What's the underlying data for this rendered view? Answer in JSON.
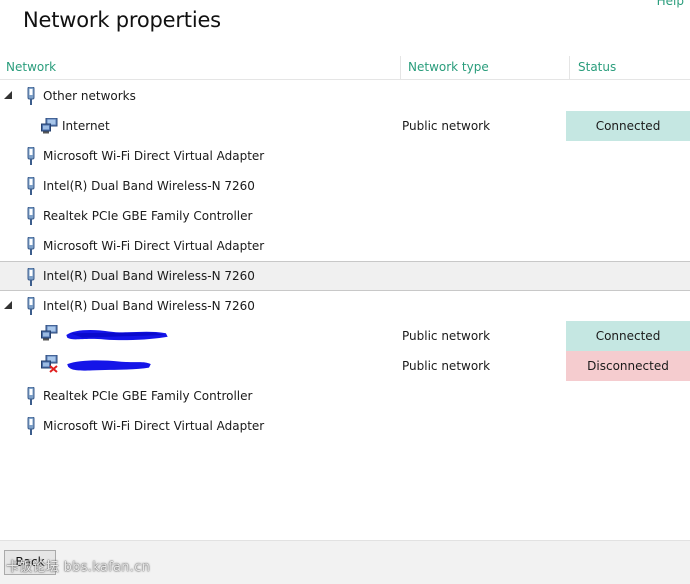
{
  "header": {
    "title": "Network properties",
    "help_label": "Help"
  },
  "columns": {
    "network": "Network",
    "network_type": "Network type",
    "status": "Status"
  },
  "colors": {
    "accent": "#2a9d7c",
    "connected": "#c5e7e2",
    "disconnected": "#f5cccf"
  },
  "rows": [
    {
      "kind": "group",
      "label": "Other networks",
      "expanded": true,
      "icon": "network-adapter-icon"
    },
    {
      "kind": "network",
      "label": "Internet",
      "type": "Public network",
      "status": "Connected",
      "icon": "network-computer-icon"
    },
    {
      "kind": "adapter",
      "label": "Microsoft Wi-Fi Direct Virtual Adapter",
      "icon": "network-adapter-icon"
    },
    {
      "kind": "adapter",
      "label": "Intel(R) Dual Band Wireless-N 7260",
      "icon": "network-adapter-icon"
    },
    {
      "kind": "adapter",
      "label": "Realtek PCIe GBE Family Controller",
      "icon": "network-adapter-icon"
    },
    {
      "kind": "adapter",
      "label": "Microsoft Wi-Fi Direct Virtual Adapter",
      "icon": "network-adapter-icon"
    },
    {
      "kind": "adapter",
      "label": "Intel(R) Dual Band Wireless-N 7260",
      "selected": true,
      "icon": "network-adapter-icon"
    },
    {
      "kind": "group",
      "label": "Intel(R) Dual Band Wireless-N 7260",
      "expanded": true,
      "icon": "network-adapter-icon"
    },
    {
      "kind": "network",
      "label": "",
      "redacted": true,
      "type": "Public network",
      "status": "Connected",
      "icon": "network-computer-icon"
    },
    {
      "kind": "network",
      "label": "",
      "redacted": true,
      "type": "Public network",
      "status": "Disconnected",
      "icon": "network-computer-disconnected-icon"
    },
    {
      "kind": "adapter",
      "label": "Realtek PCIe GBE Family Controller",
      "icon": "network-adapter-icon"
    },
    {
      "kind": "adapter",
      "label": "Microsoft Wi-Fi Direct Virtual Adapter",
      "icon": "network-adapter-icon"
    }
  ],
  "footer": {
    "button_label": "Back",
    "watermark": "卡饭论坛 bbs.kafan.cn"
  }
}
